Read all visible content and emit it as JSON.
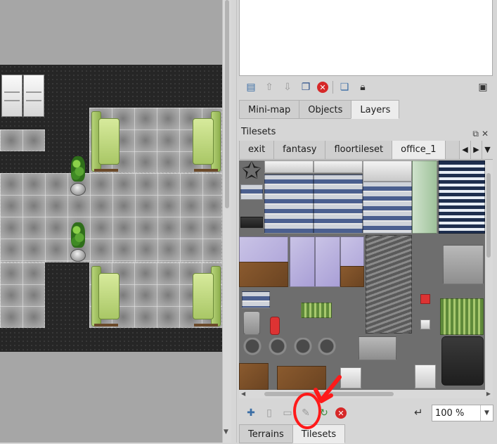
{
  "layers_panel": {
    "toolbar_icons": [
      "new-layer-icon",
      "raise-layer-icon",
      "lower-layer-icon",
      "duplicate-layer-icon",
      "remove-layer-icon",
      "layer-group-icon",
      "lock-layer-icon",
      "highlight-layer-icon"
    ],
    "tabs": [
      {
        "label": "Mini-map",
        "active": false
      },
      {
        "label": "Objects",
        "active": false
      },
      {
        "label": "Layers",
        "active": true
      }
    ]
  },
  "tilesets_panel": {
    "title": "Tilesets",
    "tabs": [
      {
        "label": "exit",
        "active": false
      },
      {
        "label": "fantasy",
        "active": false
      },
      {
        "label": "floortileset",
        "active": false
      },
      {
        "label": "office_1",
        "active": true
      }
    ],
    "toolbar_icons": [
      "new-tileset-icon",
      "embed-tileset-icon",
      "export-tileset-icon",
      "edit-tileset-icon",
      "replace-tileset-icon",
      "remove-tileset-icon"
    ],
    "zoom": "100 %",
    "bottom_tabs": [
      {
        "label": "Terrains",
        "active": false
      },
      {
        "label": "Tilesets",
        "active": true
      }
    ]
  },
  "colors": {
    "panel_bg": "#d6d6d6",
    "annotation": "#ff1a1a",
    "map_dark_floor": "#262626"
  }
}
